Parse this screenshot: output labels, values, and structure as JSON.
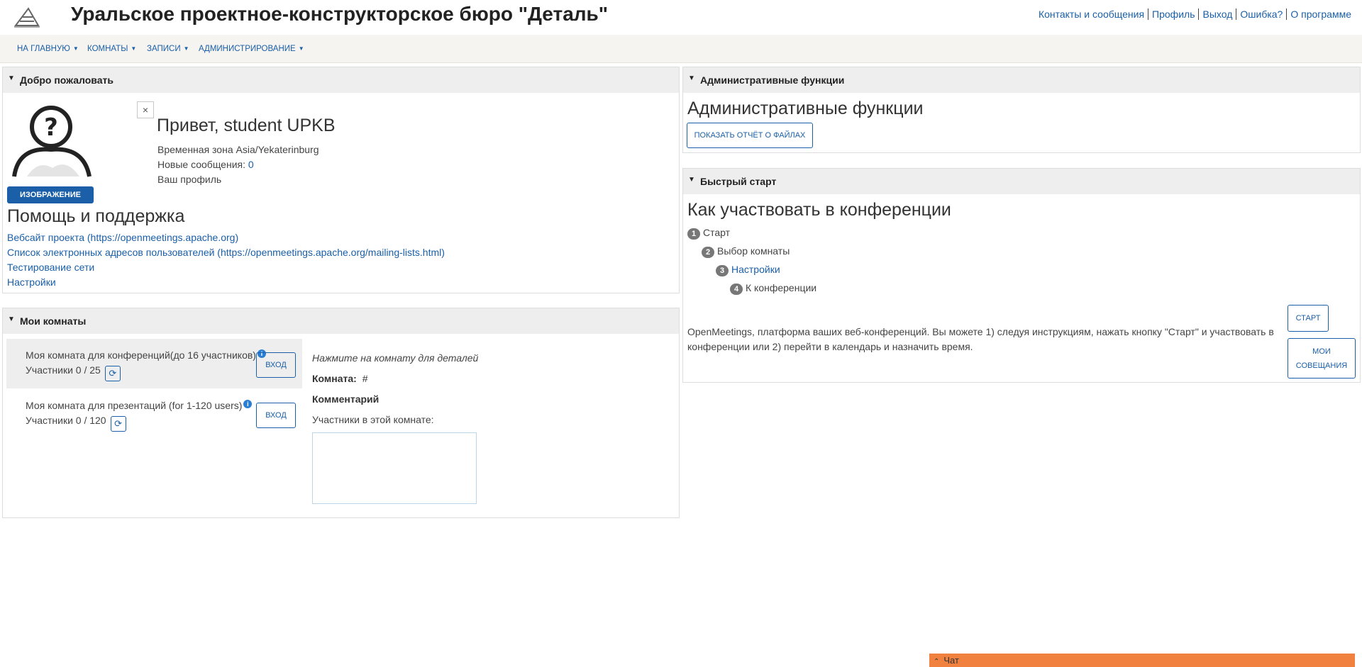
{
  "header": {
    "title": "Уральское проектное-конструкторское бюро \"Деталь\"",
    "links": [
      "Контакты и сообщения",
      "Профиль",
      "Выход",
      "Ошибка?",
      "О программе"
    ]
  },
  "menu": {
    "items": [
      "НА ГЛАВНУЮ",
      "КОМНАТЫ",
      "ЗАПИСИ",
      "АДМИНИСТРИРОВАНИЕ"
    ]
  },
  "welcome": {
    "panel_title": "Добро пожаловать",
    "close_symbol": "×",
    "photo_button": "ИЗОБРАЖЕНИЕ",
    "greeting": "Привет, student UPKB",
    "timezone": "Временная зона Asia/Yekaterinburg",
    "messages_label": "Новые сообщения:",
    "messages_count": "0",
    "profile_link": "Ваш профиль",
    "help_title": "Помощь и поддержка",
    "help_links": [
      "Вебсайт проекта (https://openmeetings.apache.org)",
      "Список электронных адресов пользователей (https://openmeetings.apache.org/mailing-lists.html)",
      "Тестирование сети",
      "Настройки"
    ]
  },
  "rooms": {
    "panel_title": "Мои комнаты",
    "items": [
      {
        "name": "Моя комната для конференций(до 16 участников)",
        "count": "Участники 0 / 25",
        "enter": "ВХОД"
      },
      {
        "name": "Моя комната для презентаций (for 1-120 users)",
        "count": "Участники 0 / 120",
        "enter": "ВХОД"
      }
    ],
    "detail_hint": "Нажмите на комнату для деталей",
    "room_label": "Комната:",
    "room_value": "#",
    "comment_label": "Комментарий",
    "participants_label": "Участники в этой комнате:"
  },
  "admin": {
    "panel_title": "Административные функции",
    "heading": "Административные функции",
    "files_report_button": "ПОКАЗАТЬ ОТЧЁТ О ФАЙЛАХ"
  },
  "quickstart": {
    "panel_title": "Быстрый старт",
    "heading": "Как участвовать в конференции",
    "steps": [
      {
        "num": "1",
        "label": "Старт"
      },
      {
        "num": "2",
        "label": "Выбор комнаты"
      },
      {
        "num": "3",
        "label": "Настройки"
      },
      {
        "num": "4",
        "label": "К конференции"
      }
    ],
    "start_button": "СТАРТ",
    "meetings_button_line1": "МОИ",
    "meetings_button_line2": "СОВЕЩАНИЯ",
    "description": "OpenMeetings, платформа ваших веб-конференций. Вы можете 1) следуя инструкциям, нажать кнопку \"Старт\" и участвовать в конференции или 2) перейти в календарь и назначить время."
  },
  "chat": {
    "label": "Чат"
  },
  "colors": {
    "link": "#1a5fa8",
    "panel_header": "#eeeeee",
    "chat_bar": "#f0813f"
  }
}
